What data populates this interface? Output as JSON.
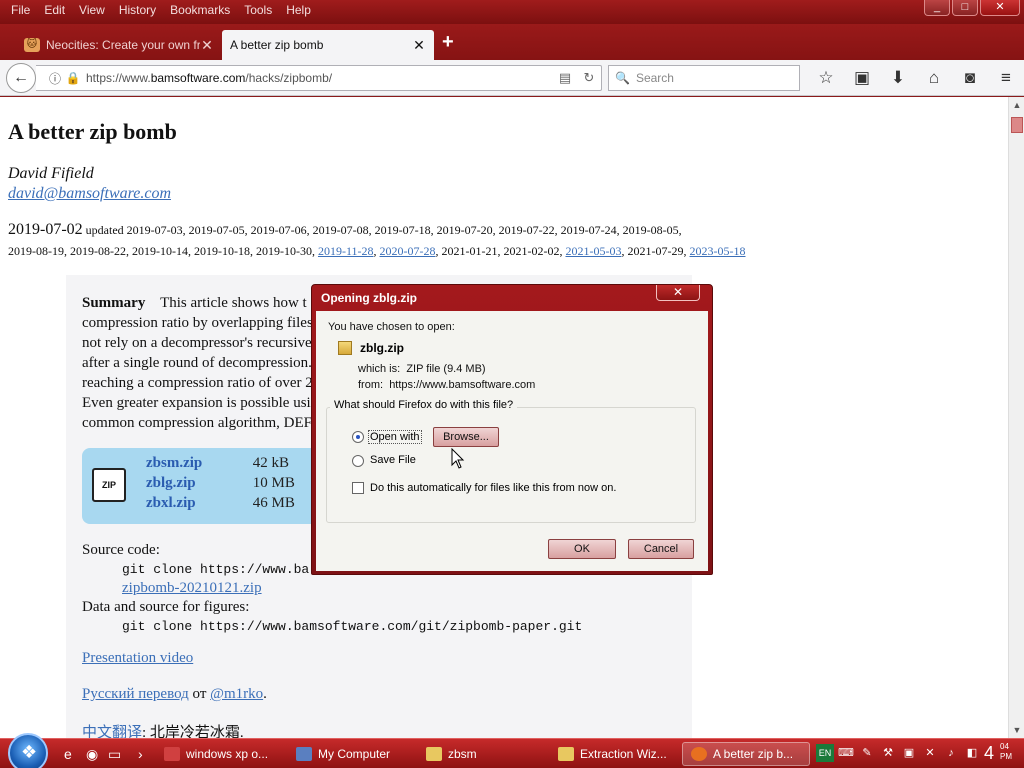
{
  "window": {
    "menu": [
      "File",
      "Edit",
      "View",
      "History",
      "Bookmarks",
      "Tools",
      "Help"
    ],
    "controls": [
      "_",
      "□",
      "✕"
    ]
  },
  "tabs": [
    {
      "title": "Neocities: Create your own fr...",
      "active": false
    },
    {
      "title": "A better zip bomb",
      "active": true
    }
  ],
  "nav": {
    "url_prefix": "https://www.",
    "url_domain": "bamsoftware.com",
    "url_path": "/hacks/zipbomb/",
    "search_placeholder": "Search"
  },
  "article": {
    "title": "A better zip bomb",
    "author": "David Fifield",
    "email": "david@bamsoftware.com",
    "date": "2019-07-02",
    "updated_label": "updated",
    "updated_line1": "2019-07-03, 2019-07-05, 2019-07-06, 2019-07-08, 2019-07-18, 2019-07-20, 2019-07-22, 2019-07-24, 2019-08-05,",
    "updated_line2_plain": "2019-08-19, 2019-08-22, 2019-10-14, 2019-10-18, 2019-10-30,",
    "updated_link1": "2019-11-28",
    "updated_link2": "2020-07-28",
    "updated_mid": ", 2021-01-21, 2021-02-02,",
    "updated_link3": "2021-05-03",
    "updated_mid2": ", 2021-07-29,",
    "updated_link4": "2023-05-18",
    "summary_label": "Summary",
    "summary_lines": [
      "This article shows how t",
      "compression ratio by overlapping files",
      "not rely on a decompressor's recursive",
      "after a single round of decompression.",
      "reaching a compression ratio of over 2",
      "Even greater expansion is possible usin",
      "common compression algorithm, DEF"
    ],
    "files": [
      {
        "name": "zbsm.zip",
        "size": "42 kB"
      },
      {
        "name": "zblg.zip",
        "size": "10 MB"
      },
      {
        "name": "zbxl.zip",
        "size": "46 MB"
      }
    ],
    "zip_icon_text": "ZIP",
    "source_label": "Source code:",
    "source_git": "git clone https://www.ba",
    "source_zip": "zipbomb-20210121.zip",
    "data_label": "Data and source for figures:",
    "data_git": "git clone https://www.bamsoftware.com/git/zipbomb-paper.git",
    "video_link": "Presentation video",
    "ru_link": "Русский перевод",
    "ru_from": " от ",
    "ru_author": "@m1rko",
    "ru_end": ".",
    "zh_link": "中文翻译",
    "zh_rest": ": 北岸冷若冰霜."
  },
  "dialog": {
    "title": "Opening zblg.zip",
    "close": "✕",
    "chosen": "You have chosen to open:",
    "filename": "zblg.zip",
    "which_is_label": "which is:",
    "which_is_value": "ZIP file (9.4 MB)",
    "from_label": "from:",
    "from_value": "https://www.bamsoftware.com",
    "question": "What should Firefox do with this file?",
    "open_with": "Open with",
    "browse": "Browse...",
    "save_file": "Save File",
    "auto": "Do this automatically for files like this from now on.",
    "ok": "OK",
    "cancel": "Cancel",
    "open_with_selected": true
  },
  "taskbar": {
    "tasks": [
      {
        "label": "windows xp o...",
        "color": "#d04040"
      },
      {
        "label": "My Computer",
        "color": "#5a7fc0"
      },
      {
        "label": "zbsm",
        "color": "#e8c860"
      },
      {
        "label": "Extraction Wiz...",
        "color": "#e8c860"
      },
      {
        "label": "A better zip b...",
        "color": "#e87020"
      }
    ],
    "lang": "EN",
    "time": "4",
    "time_small": "04",
    "ampm": "PM"
  },
  "colors": {
    "accent": "#8b1a1a",
    "link": "#3b6fb8",
    "files_bg": "#a8d8f0"
  }
}
